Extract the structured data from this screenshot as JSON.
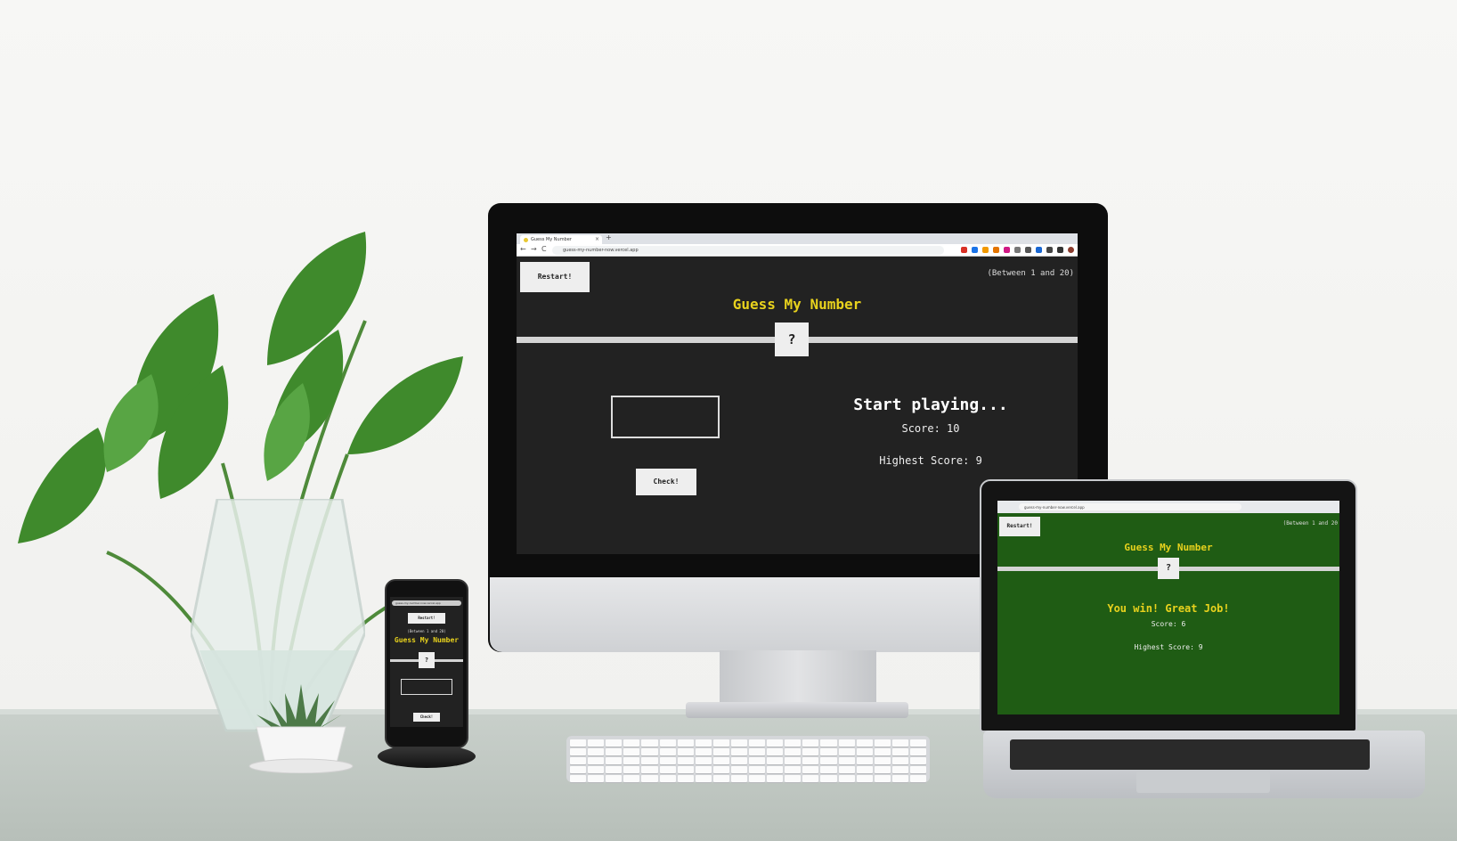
{
  "browser": {
    "tab_title": "Guess My Number",
    "new_tab": "+",
    "close_tab": "×",
    "url": "guess-my-number-now.vercel.app",
    "back": "←",
    "forward": "→",
    "reload": "C"
  },
  "laptop_browser": {
    "url": "guess-my-number-now.vercel.app"
  },
  "phone_browser": {
    "url": "guess-my-number-now.vercel.app"
  },
  "desktop_game": {
    "restart_label": "Restart!",
    "range_text": "(Between 1 and 20)",
    "title": "Guess My Number",
    "secret": "?",
    "check_label": "Check!",
    "message": "Start playing...",
    "score_text": "Score: 10",
    "highscore_text": "Highest Score: 9",
    "background_color": "#222222",
    "accent_color": "#e8d21d"
  },
  "laptop_game": {
    "restart_label": "Restart!",
    "range_text": "(Between 1 and 20",
    "title": "Guess My Number",
    "secret": "?",
    "message": "You win! Great Job!",
    "score_text": "Score: 6",
    "highscore_text": "Highest Score: 9",
    "background_color": "#1f5c14"
  },
  "phone_game": {
    "restart_label": "Restart!",
    "range_text": "(Between 1 and 20)",
    "title": "Guess My Number",
    "secret": "?",
    "check_label": "Check!"
  }
}
